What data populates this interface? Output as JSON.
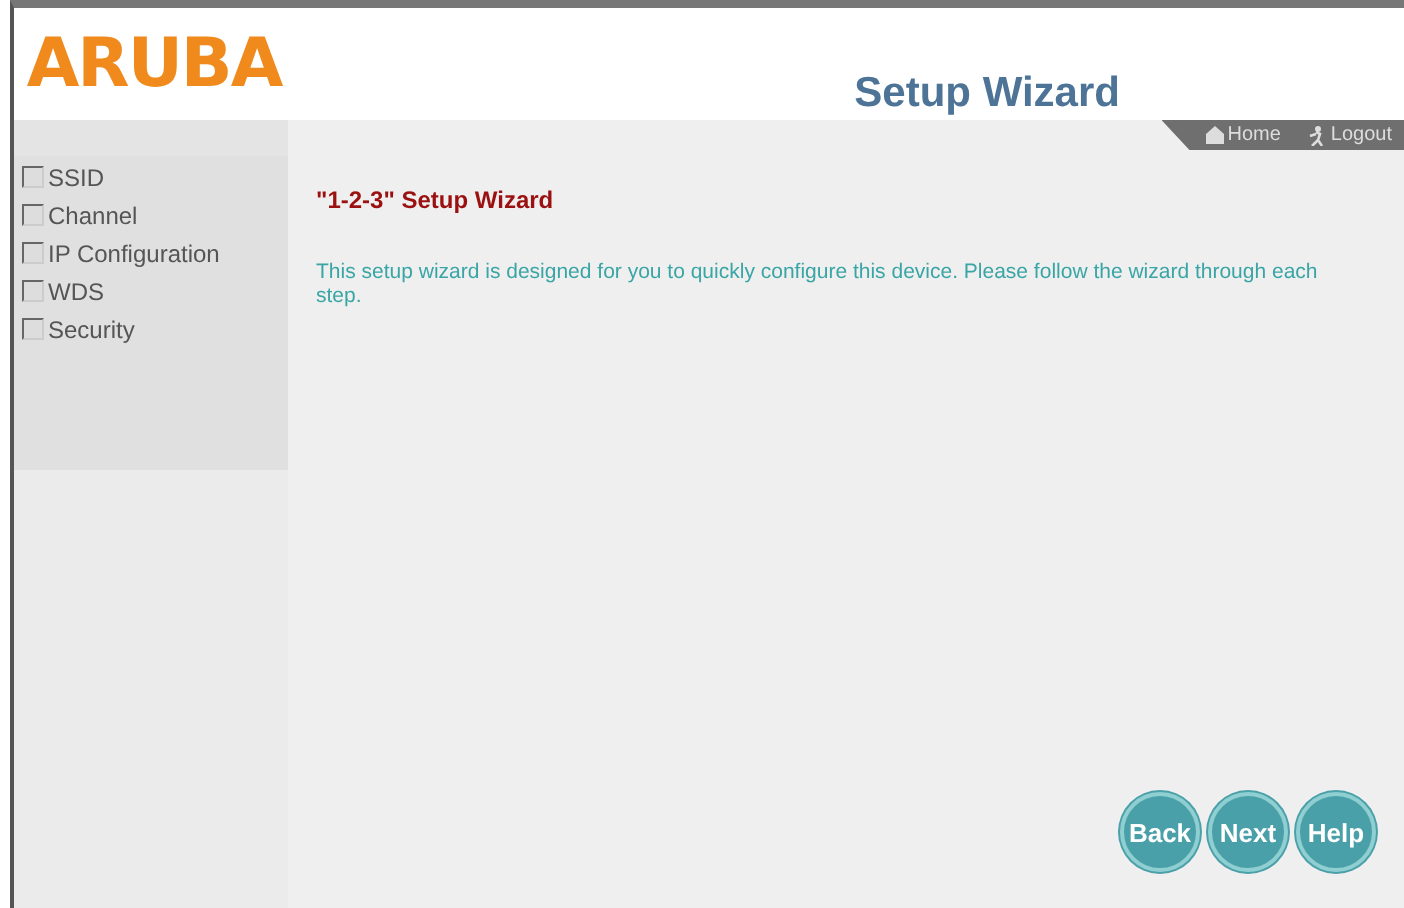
{
  "logo": "ARUBA",
  "header": {
    "title": "Setup Wizard"
  },
  "top_links": [
    {
      "label": "Home",
      "kind": "home"
    },
    {
      "label": "Logout",
      "kind": "logout"
    }
  ],
  "sidebar": {
    "items": [
      {
        "label": "SSID",
        "checked": false
      },
      {
        "label": "Channel",
        "checked": false
      },
      {
        "label": "IP Configuration",
        "checked": false
      },
      {
        "label": "WDS",
        "checked": false
      },
      {
        "label": "Security",
        "checked": false
      }
    ]
  },
  "content": {
    "heading": "\"1-2-3\" Setup Wizard",
    "description": "This setup wizard is designed for you to quickly configure this device. Please follow the wizard through each step."
  },
  "buttons": [
    "Back",
    "Next",
    "Help"
  ]
}
